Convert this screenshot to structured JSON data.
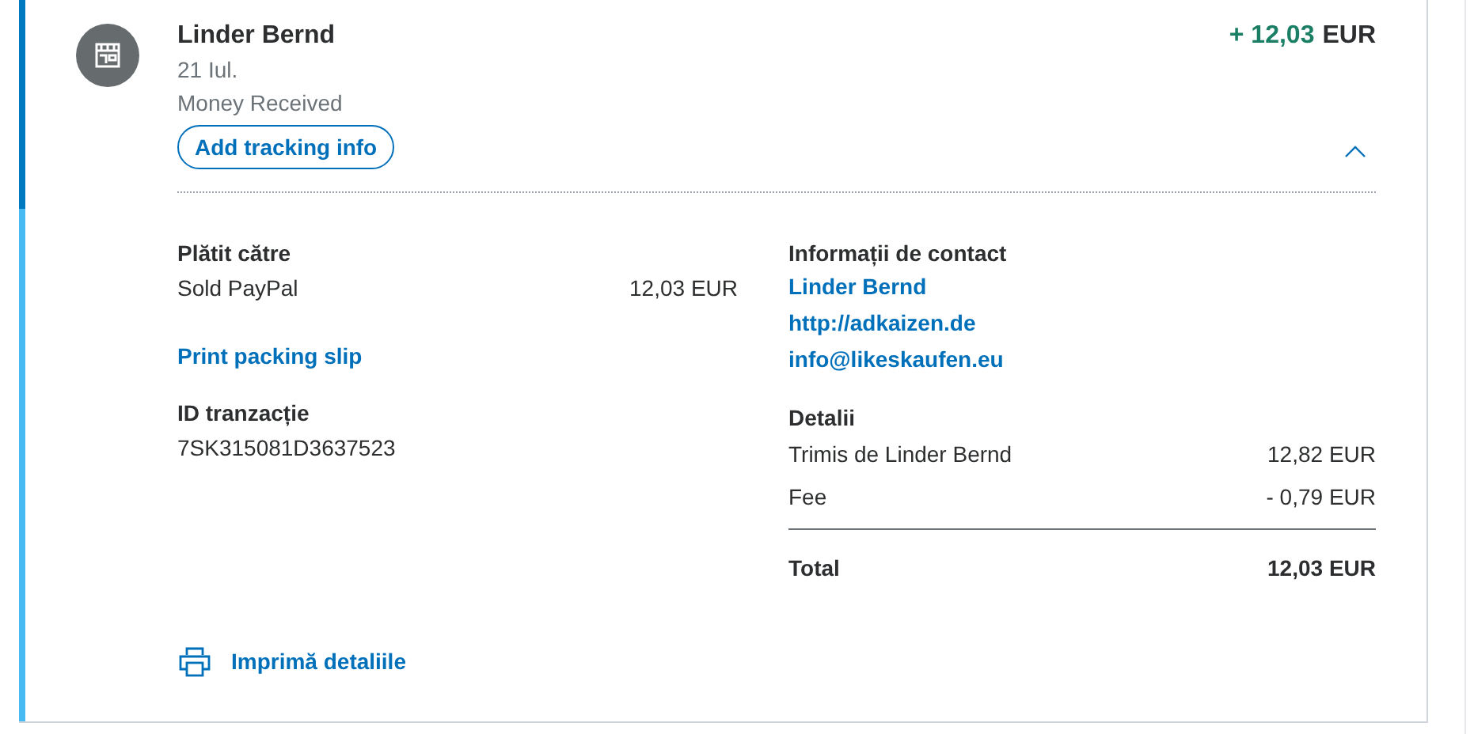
{
  "transaction": {
    "name": "Linder Bernd",
    "date": "21 Iul.",
    "type": "Money Received",
    "amount": "+ 12,03",
    "currency": "EUR",
    "expanded": true,
    "tracking_button": "Add tracking info"
  },
  "paid_to": {
    "heading": "Plătit către",
    "account": "Sold PayPal",
    "amount": "12,03 EUR"
  },
  "packing_slip_link": "Print packing slip",
  "transaction_id": {
    "heading": "ID tranzacție",
    "value": "7SK315081D3637523"
  },
  "contact": {
    "heading": "Informații de contact",
    "links": [
      "Linder Bernd",
      "http://adkaizen.de",
      "info@likeskaufen.eu"
    ]
  },
  "details": {
    "heading": "Detalii",
    "rows": [
      {
        "label": "Trimis de Linder Bernd",
        "value": "12,82 EUR"
      },
      {
        "label": "Fee",
        "value": "- 0,79 EUR"
      }
    ],
    "total": {
      "label": "Total",
      "value": "12,03 EUR"
    }
  },
  "print_link": "Imprimă detaliile"
}
